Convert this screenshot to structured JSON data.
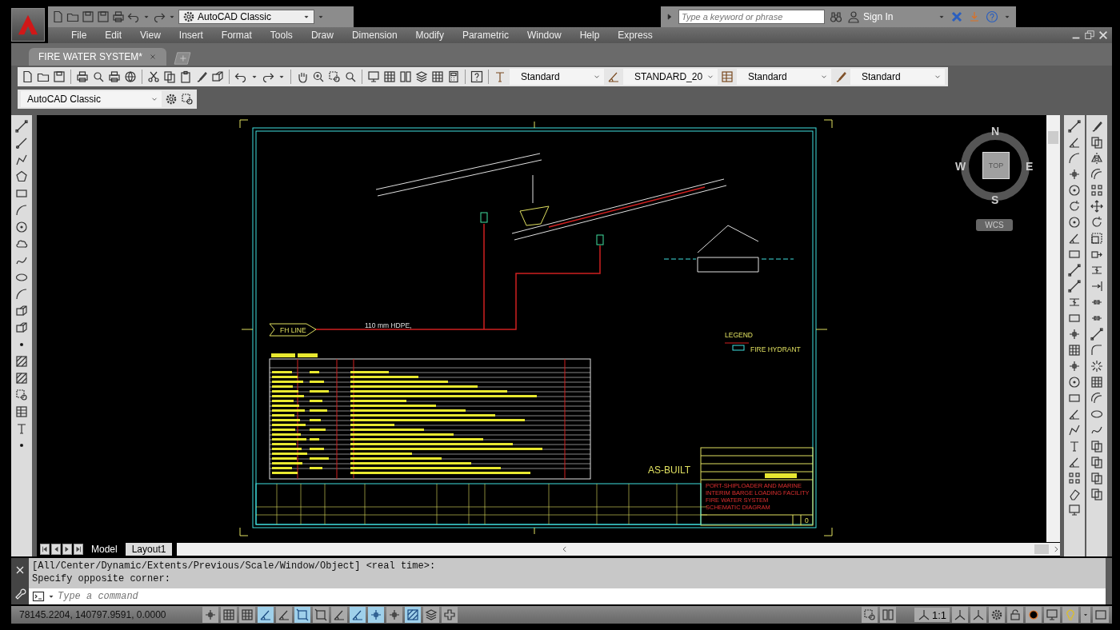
{
  "quick_access": {
    "workspace": "AutoCAD Classic"
  },
  "search": {
    "placeholder": "Type a keyword or phrase"
  },
  "sign_in": "Sign In",
  "menu": [
    "File",
    "Edit",
    "View",
    "Insert",
    "Format",
    "Tools",
    "Draw",
    "Dimension",
    "Modify",
    "Parametric",
    "Window",
    "Help",
    "Express"
  ],
  "document_tabs": [
    {
      "label": "FIRE WATER SYSTEM*",
      "selected": true
    }
  ],
  "style_selects": [
    "Standard",
    "STANDARD_20",
    "Standard",
    "Standard"
  ],
  "workspace_select": "AutoCAD Classic",
  "viewcube": {
    "north": "N",
    "south": "S",
    "east": "E",
    "west": "W",
    "face": "TOP",
    "ucs": "WCS"
  },
  "drawing": {
    "line_tag": "FH LINE",
    "pipe_label": "110 mm HDPE,",
    "legend_title": "LEGEND",
    "legend_items": [
      "FIRE HYDRANT"
    ],
    "stamp": "AS-BUILT",
    "title_lines": [
      "PORT-SHIPLOADER AND MARINE",
      "INTERIM BARGE LOADING FACILITY",
      "FIRE WATER SYSTEM",
      "SCHEMATIC DIAGRAM"
    ],
    "revision": "0"
  },
  "layout_tabs": [
    {
      "label": "Model",
      "selected": true
    },
    {
      "label": "Layout1",
      "selected": false
    }
  ],
  "command_history": [
    "[All/Center/Dynamic/Extents/Previous/Scale/Window/Object] <real time>:",
    "Specify opposite corner:"
  ],
  "command_input": {
    "placeholder": "Type a command"
  },
  "status": {
    "coordinates": "78145.2204, 140797.9591, 0.0000",
    "scale": "1:1"
  },
  "status_toggles": [
    {
      "on": false
    },
    {
      "on": false
    },
    {
      "on": false
    },
    {
      "on": true
    },
    {
      "on": false
    },
    {
      "on": true
    },
    {
      "on": false
    },
    {
      "on": false
    },
    {
      "on": true
    },
    {
      "on": true
    },
    {
      "on": false
    },
    {
      "on": true
    },
    {
      "on": false
    },
    {
      "on": false
    }
  ]
}
